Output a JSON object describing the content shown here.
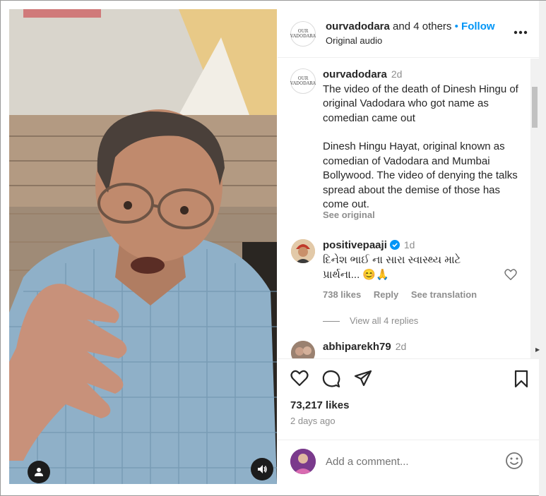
{
  "header": {
    "owner": "ourvadodara",
    "collaborators": "and 4 others",
    "separator": "•",
    "follow_label": "Follow",
    "audio": "Original audio",
    "more_icon": "more-horizontal-icon",
    "avatar_text": "OUR VADODARA"
  },
  "caption": {
    "username": "ourvadodara",
    "time": "2d",
    "paragraph1": "The video of the death of Dinesh Hingu of original Vadodara who got name as comedian came out",
    "paragraph2": "Dinesh Hingu Hayat, original known as comedian of Vadodara and Mumbai Bollywood. The video of denying the talks spread about the demise of those has come out.",
    "see_original": "See original"
  },
  "comments": [
    {
      "username": "positivepaaji",
      "verified": true,
      "time": "1d",
      "text": "દિનેશ ભાઈ ના સારા સ્વાસ્થ્ય માટે પ્રાર્થના... 😊🙏",
      "likes": "738 likes",
      "reply": "Reply",
      "see_translation": "See translation",
      "view_replies": "View all 4 replies"
    },
    {
      "username": "abhiparekh79",
      "time": "2d"
    }
  ],
  "actions": {
    "like_icon": "heart-icon",
    "comment_icon": "comment-bubble-icon",
    "share_icon": "paper-plane-icon",
    "save_icon": "bookmark-icon",
    "likes": "73,217 likes",
    "posted": "2 days ago"
  },
  "add_comment": {
    "placeholder": "Add a comment...",
    "emoji_icon": "smiley-icon"
  },
  "video": {
    "user_icon": "user-tag-icon",
    "audio_icon": "speaker-icon"
  },
  "colors": {
    "follow": "#0095f6",
    "verified": "#0095f6",
    "muted_text": "#8e8e8e"
  }
}
